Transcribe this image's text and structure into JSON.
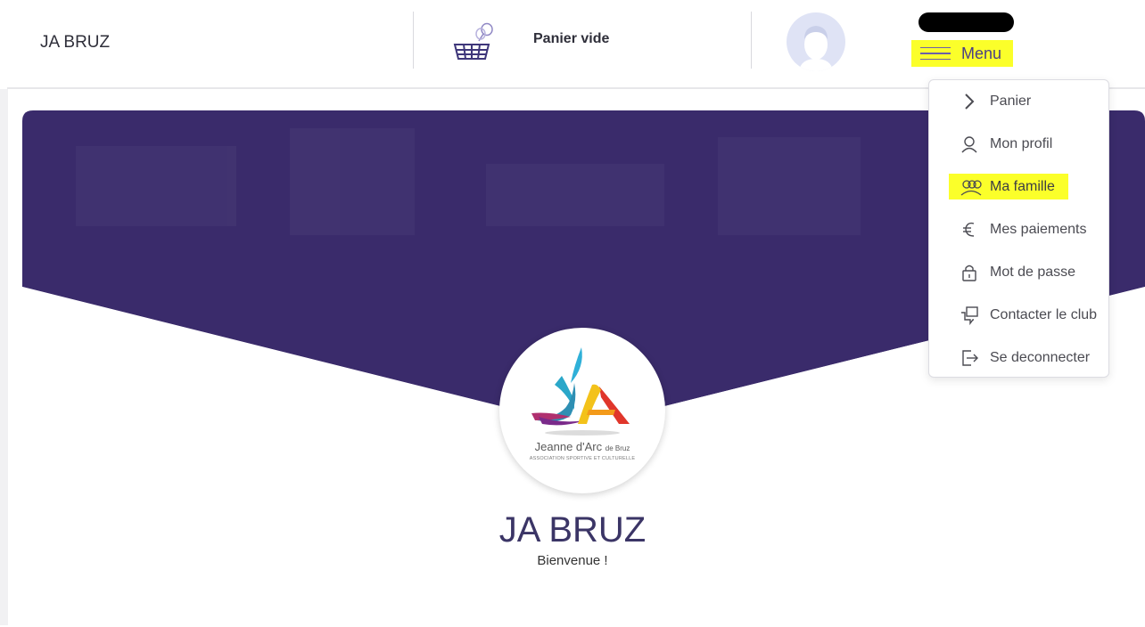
{
  "header": {
    "brand": "JA BRUZ",
    "cart_label": "Panier vide",
    "menu_label": "Menu"
  },
  "dropdown": {
    "items": [
      {
        "label": "Panier",
        "icon": "chevron-right-icon"
      },
      {
        "label": "Mon profil",
        "icon": "user-icon"
      },
      {
        "label": "Ma famille",
        "icon": "family-icon"
      },
      {
        "label": "Mes paiements",
        "icon": "euro-icon"
      },
      {
        "label": "Mot de passe",
        "icon": "lock-icon"
      },
      {
        "label": "Contacter le club",
        "icon": "chat-icon"
      },
      {
        "label": "Se deconnecter",
        "icon": "logout-icon"
      }
    ]
  },
  "club": {
    "logo_text": "Jeanne d'Arc",
    "logo_text_small": "de Bruz",
    "logo_tagline": "ASSOCIATION SPORTIVE ET CULTURELLE",
    "name": "JA BRUZ",
    "welcome": "Bienvenue !"
  },
  "colors": {
    "banner": "#3a2b6b",
    "highlight": "#fbff2a",
    "accent": "#4a3f86"
  }
}
